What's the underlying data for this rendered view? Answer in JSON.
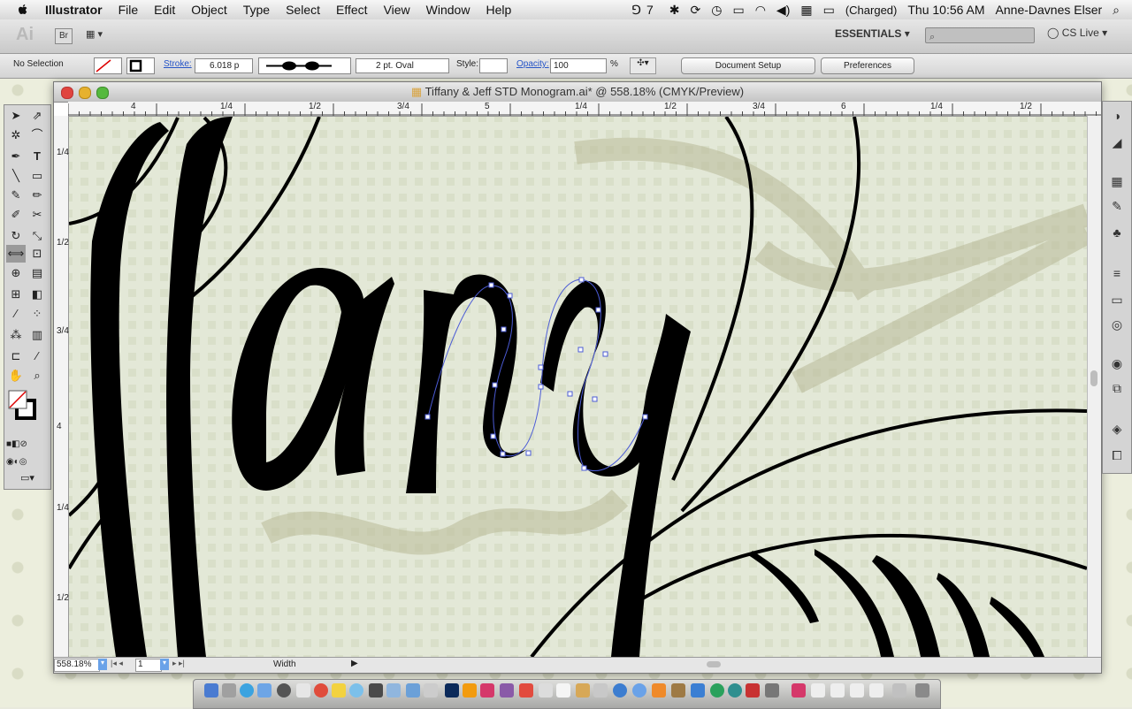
{
  "menubar": {
    "app_name": "Illustrator",
    "menus": [
      "File",
      "Edit",
      "Object",
      "Type",
      "Select",
      "Effect",
      "View",
      "Window",
      "Help"
    ],
    "status_extra": "7",
    "battery": "(Charged)",
    "clock": "Thu 10:56 AM",
    "user": "Anne-Davnes Elser"
  },
  "appbar": {
    "logo": "Ai",
    "bridge": "Br",
    "workspace": "ESSENTIALS",
    "cs_live": "CS Live"
  },
  "control": {
    "selection": "No Selection",
    "stroke_label": "Stroke:",
    "stroke_value": "6.018 p",
    "brush": "2 pt. Oval",
    "style_label": "Style:",
    "opacity_label": "Opacity:",
    "opacity_value": "100",
    "percent": "%",
    "doc_setup": "Document Setup",
    "preferences": "Preferences"
  },
  "document": {
    "title": "Tiffany & Jeff STD Monogram.ai* @ 558.18% (CMYK/Preview)",
    "ruler_top": [
      "4",
      "1/4",
      "1/2",
      "3/4",
      "5",
      "1/4",
      "1/2",
      "3/4",
      "6",
      "1/4",
      "1/2"
    ],
    "ruler_left": [
      "1/4",
      "1/2",
      "3/4",
      "4",
      "1/4",
      "1/2"
    ]
  },
  "status": {
    "zoom": "558.18%",
    "page": "1",
    "tool_label": "Width"
  },
  "colors": {
    "accent": "#2554c7",
    "canvas_bg": "#e3e8d7",
    "ink": "#000000"
  }
}
